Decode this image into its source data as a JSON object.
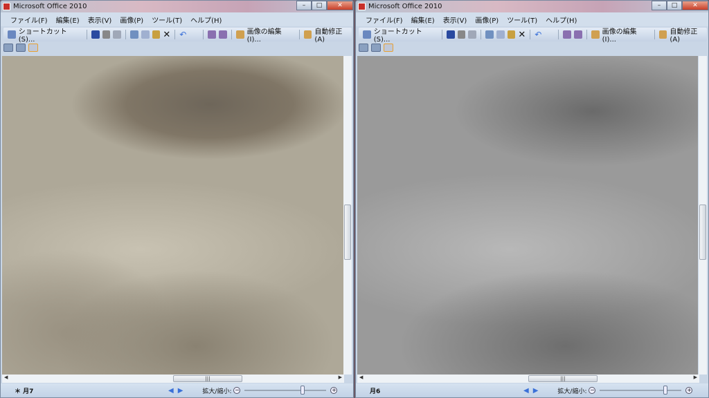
{
  "windows": [
    {
      "title": "Microsoft Office 2010",
      "menu": [
        "ファイル(F)",
        "編集(E)",
        "表示(V)",
        "画像(P)",
        "ツール(T)",
        "ヘルプ(H)"
      ],
      "toolbar": {
        "shortcut": "ショートカット(S)...",
        "edit_image": "画像の編集(I)...",
        "auto_correct": "自動修正(A)"
      },
      "status": {
        "filename": "＊ 月7",
        "zoom_label": "拡大/縮小:",
        "zoom_level": 0.72
      }
    },
    {
      "title": "Microsoft Office 2010",
      "menu": [
        "ファイル(F)",
        "編集(E)",
        "表示(V)",
        "画像(P)",
        "ツール(T)",
        "ヘルプ(H)"
      ],
      "toolbar": {
        "shortcut": "ショートカット(S)...",
        "edit_image": "画像の編集(I)...",
        "auto_correct": "自動修正(A)"
      },
      "status": {
        "filename": "月6",
        "zoom_label": "拡大/縮小:",
        "zoom_level": 0.82
      }
    }
  ]
}
